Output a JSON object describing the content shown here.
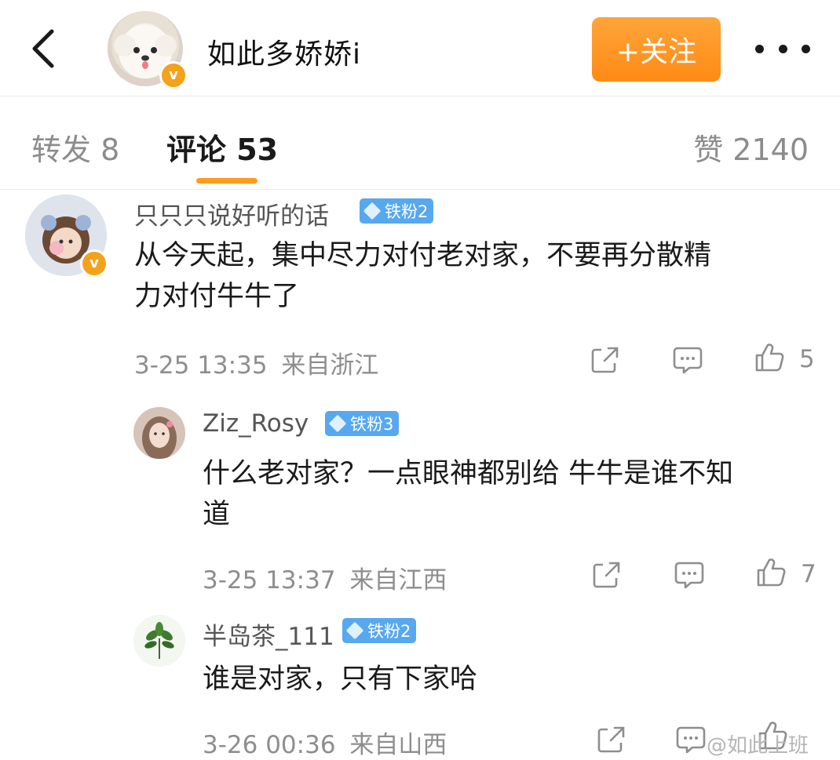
{
  "header": {
    "back_icon": "chevron-left-icon",
    "author_name": "如此多娇娇i",
    "follow_label": "+关注",
    "more_icon": "more-dots-icon",
    "accent": "#ff9a1a"
  },
  "tabs": {
    "repost": "转发 8",
    "comment": "评论 53",
    "like": "赞 2140"
  },
  "comments": [
    {
      "username": "只只只说好听的话",
      "fan_badge": "铁粉2",
      "text_line1": "从今天起，集中尽力对付老对家，不要再分散精",
      "text_line2": "力对付牛牛了",
      "time": "3-25 13:35",
      "location": "来自浙江",
      "likes": "5"
    },
    {
      "username": "Ziz_Rosy",
      "fan_badge": "铁粉3",
      "text_line1": "什么老对家？一点眼神都别给 牛牛是谁不知",
      "text_line2": "道",
      "time": "3-25 13:37",
      "location": "来自江西",
      "likes": "7"
    },
    {
      "username": "半岛茶_111",
      "fan_badge": "铁粉2",
      "text_line1": "谁是对家，只有下家哈",
      "time": "3-26 00:36",
      "location": "来自山西",
      "likes": ""
    }
  ],
  "watermark": "@如此上班"
}
